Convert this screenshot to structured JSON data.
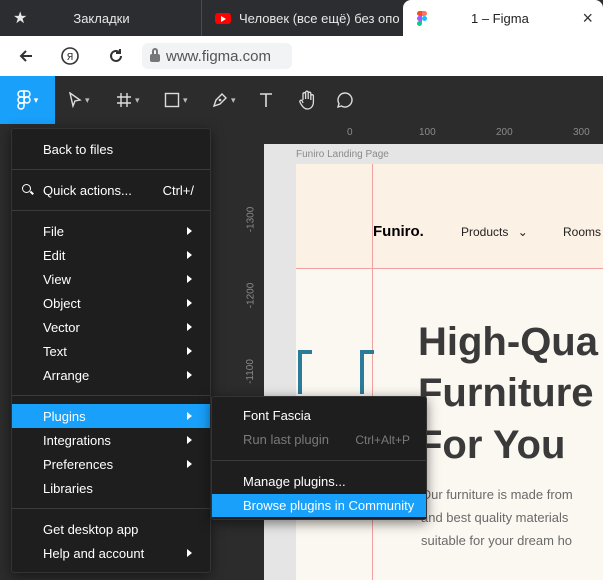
{
  "browser": {
    "tabs": [
      {
        "title": "Закладки"
      },
      {
        "title": "Человек (все ещё) без опо"
      },
      {
        "title": "1 – Figma"
      }
    ],
    "url": "www.figma.com"
  },
  "canvas": {
    "ruler_top": [
      "0",
      "100",
      "200",
      "300"
    ],
    "ruler_left": [
      "-1300",
      "-1200",
      "-1100"
    ],
    "frame_label": "Funiro Landing Page",
    "brand": "Funiro.",
    "nav": {
      "products": "Products",
      "rooms": "Rooms"
    },
    "headline": [
      "High-Qua",
      "Furniture",
      "For You"
    ],
    "body": [
      "Our furniture is made from",
      "and best quality materials",
      "suitable for your dream ho"
    ]
  },
  "main_menu": {
    "back": "Back to files",
    "quick_actions": {
      "label": "Quick actions...",
      "shortcut": "Ctrl+/"
    },
    "items": [
      {
        "label": "File"
      },
      {
        "label": "Edit"
      },
      {
        "label": "View"
      },
      {
        "label": "Object"
      },
      {
        "label": "Vector"
      },
      {
        "label": "Text"
      },
      {
        "label": "Arrange"
      }
    ],
    "plugins": "Plugins",
    "integrations": "Integrations",
    "preferences": "Preferences",
    "libraries": "Libraries",
    "desktop_app": "Get desktop app",
    "help": "Help and account"
  },
  "plugins_menu": {
    "font_fascia": "Font Fascia",
    "run_last": {
      "label": "Run last plugin",
      "shortcut": "Ctrl+Alt+P"
    },
    "manage": "Manage plugins...",
    "browse": "Browse plugins in Community"
  },
  "colors": {
    "accent": "#18a0fb",
    "menu_bg": "#1e1e1e",
    "toolbar_bg": "#2c2c2c"
  }
}
